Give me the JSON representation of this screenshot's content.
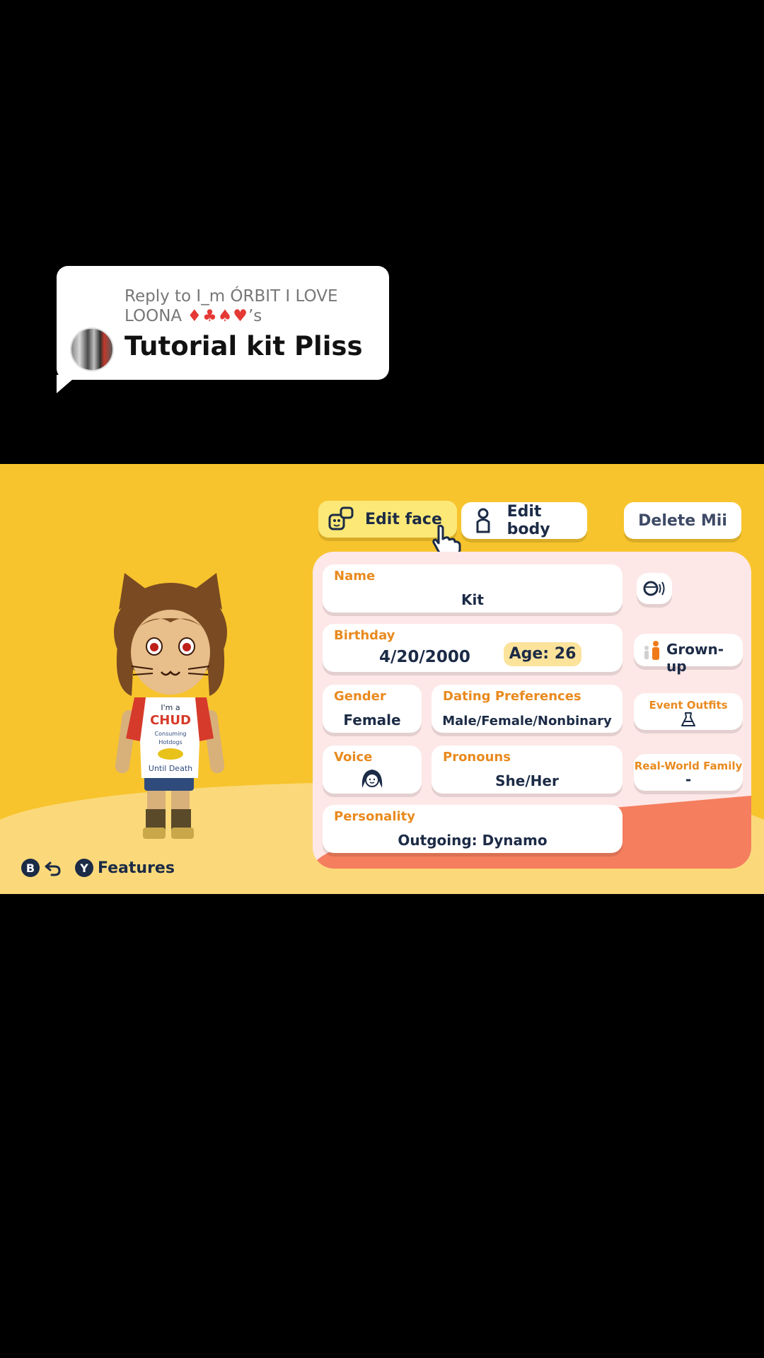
{
  "reply": {
    "reply_to": "Reply to I_m ÓRBIT I LOVE LOONA",
    "suits": "♦♣♠♥",
    "suffix": "’s",
    "title": "Tutorial kit Pliss"
  },
  "buttons": {
    "edit_face": "Edit face",
    "edit_body": "Edit body",
    "delete_mii": "Delete Mii"
  },
  "fields": {
    "name_label": "Name",
    "name_value": "Kit",
    "birthday_label": "Birthday",
    "birthday_value": "4/20/2000",
    "age": "Age: 26",
    "gender_label": "Gender",
    "gender_value": "Female",
    "dating_label": "Dating Preferences",
    "dating_value": "Male/Female/Nonbinary",
    "voice_label": "Voice",
    "pronouns_label": "Pronouns",
    "pronouns_value": "She/Her",
    "personality_label": "Personality",
    "personality_value": "Outgoing: Dynamo"
  },
  "side": {
    "grownup": "Grown-up",
    "event_outfits": "Event Outfits",
    "family_label": "Real-World Family",
    "family_value": "-"
  },
  "shirt": [
    "I'm a",
    "CHUD",
    "Consuming",
    "Hotdogs",
    "Until Death"
  ],
  "controls": {
    "b": "B",
    "y": "Y",
    "features": "Features"
  },
  "colors": {
    "background": "#f7c42d",
    "label": "#e98a1e",
    "text": "#1c2b46",
    "panel": "#fde7e7"
  }
}
